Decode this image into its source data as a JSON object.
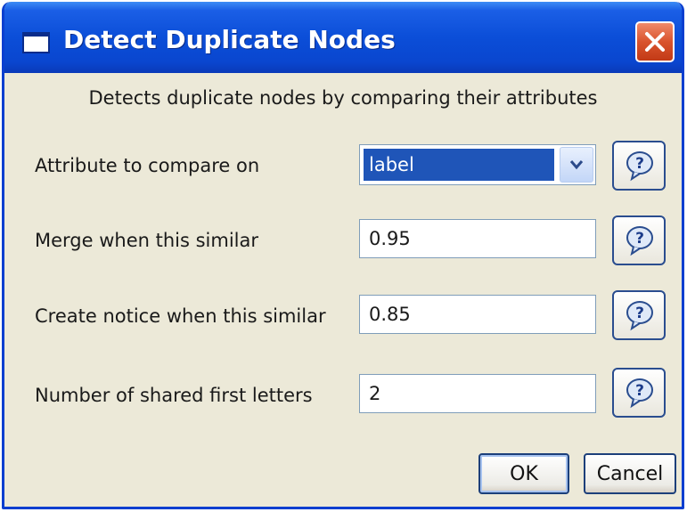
{
  "window": {
    "title": "Detect Duplicate Nodes",
    "description": "Detects duplicate nodes by comparing their attributes"
  },
  "fields": {
    "attribute": {
      "label": "Attribute to compare on",
      "value": "label"
    },
    "merge": {
      "label": "Merge when this similar",
      "value": "0.95"
    },
    "notice": {
      "label": "Create notice when this similar",
      "value": "0.85"
    },
    "shared_letters": {
      "label": "Number of shared first letters",
      "value": "2"
    }
  },
  "buttons": {
    "ok": "OK",
    "cancel": "Cancel"
  },
  "icons": {
    "title": "window-icon",
    "close": "close-icon",
    "help": "help-icon",
    "dropdown": "chevron-down-icon"
  },
  "colors": {
    "titlebar": "#0b4ed8",
    "dialog_background": "#ece9d8",
    "selection": "#1f55b8",
    "close_button": "#d9532d"
  }
}
